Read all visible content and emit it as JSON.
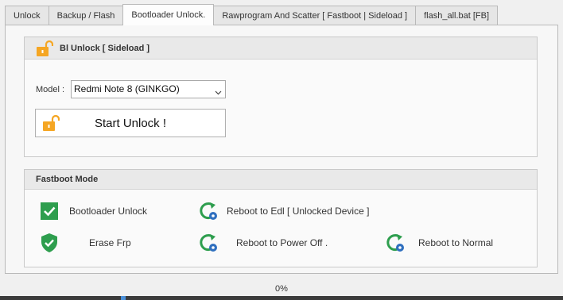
{
  "tabs": [
    {
      "label": "Unlock"
    },
    {
      "label": "Backup / Flash"
    },
    {
      "label": "Bootloader Unlock."
    },
    {
      "label": "Rawprogram And  Scatter [ Fastboot | Sideload ]"
    },
    {
      "label": "flash_all.bat [FB]"
    }
  ],
  "active_tab_index": 2,
  "unlock_group": {
    "title": "Bl Unlock [ Sideload ]",
    "icon": "open-padlock-icon",
    "model_label": "Model :",
    "model_value": "Redmi Note 8 (GINKGO)",
    "start_button": "Start Unlock !"
  },
  "fastboot_group": {
    "title": "Fastboot Mode",
    "actions": [
      {
        "label": "Bootloader Unlock",
        "icon": "green-check-icon"
      },
      {
        "label": "Reboot to Edl [ Unlocked Device ]",
        "icon": "reboot-gear-icon"
      },
      {
        "label": "Erase Frp",
        "icon": "shield-check-icon"
      },
      {
        "label": "Reboot to Power Off .",
        "icon": "reboot-gear-icon"
      },
      {
        "label": "Reboot to Normal",
        "icon": "reboot-gear-icon"
      }
    ]
  },
  "status": {
    "progress_text": "0%",
    "progress": 0
  },
  "colors": {
    "accent_green": "#2e9e4e",
    "lock_orange": "#f5a623",
    "gear_blue": "#2f6fbf"
  }
}
